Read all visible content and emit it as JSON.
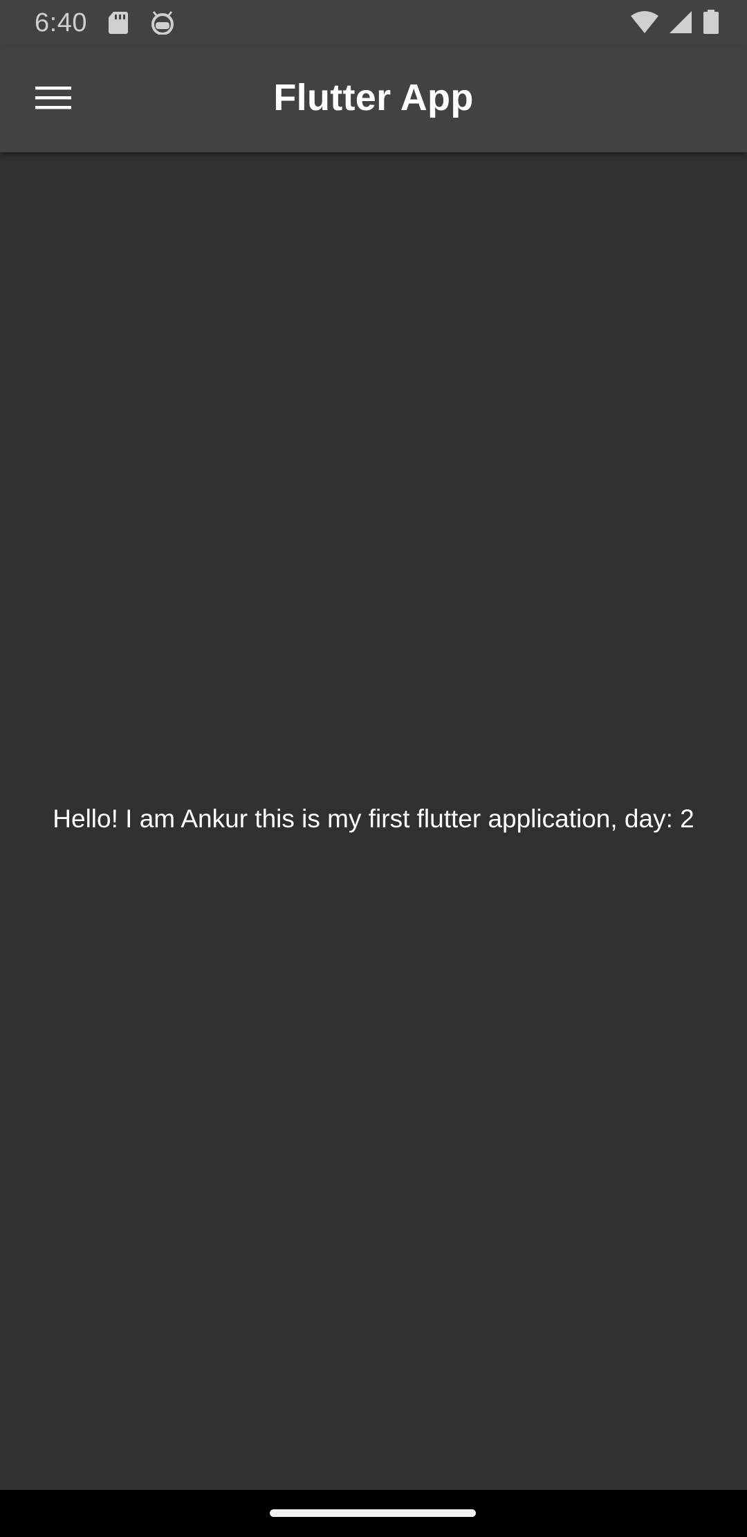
{
  "status_bar": {
    "time": "6:40",
    "left_icons": [
      "sd-card-icon",
      "android-robot-icon"
    ],
    "right_icons": [
      "wifi-icon",
      "cellular-signal-icon",
      "battery-icon"
    ]
  },
  "app_bar": {
    "title": "Flutter App",
    "menu_icon": "hamburger-menu-icon"
  },
  "body": {
    "message": "Hello! I am Ankur this is my first flutter application, day: 2"
  },
  "colors": {
    "app_bar": "#424242",
    "background": "#303030",
    "text": "#ffffff"
  }
}
